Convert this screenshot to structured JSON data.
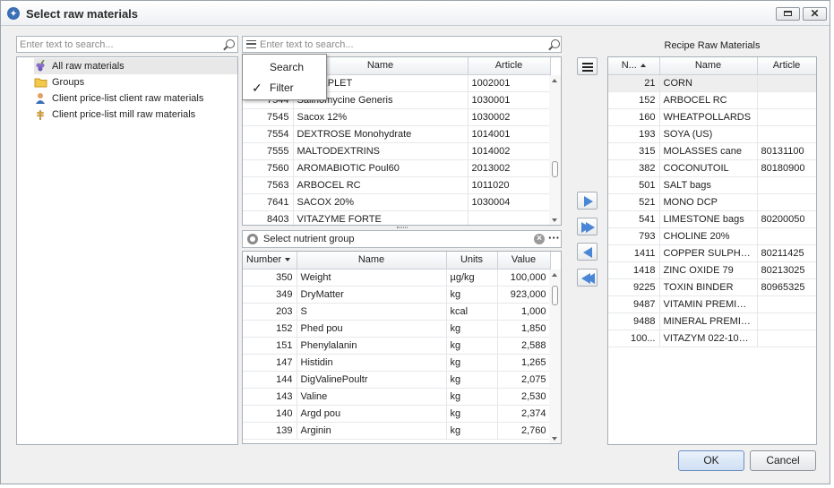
{
  "window": {
    "title": "Select raw materials",
    "app_icon_glyph": "✦"
  },
  "left": {
    "search_placeholder": "Enter text to search...",
    "tree": [
      {
        "label": "All raw materials",
        "icon": "grapes-icon",
        "color": "#8a6fc9",
        "selected": true
      },
      {
        "label": "Groups",
        "icon": "folder-icon",
        "color": "#e8b923",
        "selected": false
      },
      {
        "label": "Client price-list client raw materials",
        "icon": "client-icon",
        "color": "#d98b2b",
        "selected": false
      },
      {
        "label": "Client price-list mill raw materials",
        "icon": "wheat-icon",
        "color": "#c89b3c",
        "selected": false
      }
    ]
  },
  "center": {
    "search_placeholder": "Enter text to search...",
    "menu": {
      "items": [
        {
          "label": "Search",
          "checked": false
        },
        {
          "label": "Filter",
          "checked": true
        }
      ],
      "check_glyph": "✓"
    },
    "columns": [
      "",
      "Name",
      "Article"
    ],
    "rows": [
      {
        "number": "",
        "name": "AD GEPLET",
        "article": "1002001"
      },
      {
        "number": "7544",
        "name": "Salinomycine Generis",
        "article": "1030001"
      },
      {
        "number": "7545",
        "name": "Sacox 12%",
        "article": "1030002"
      },
      {
        "number": "7554",
        "name": "DEXTROSE Monohydrate",
        "article": "1014001"
      },
      {
        "number": "7555",
        "name": "MALTODEXTRINS",
        "article": "1014002"
      },
      {
        "number": "7560",
        "name": "AROMABIOTIC Poul60",
        "article": "2013002"
      },
      {
        "number": "7563",
        "name": "ARBOCEL RC",
        "article": "1011020"
      },
      {
        "number": "7641",
        "name": "SACOX 20%",
        "article": "1030004"
      },
      {
        "number": "8403",
        "name": "VITAZYME FORTE",
        "article": ""
      }
    ]
  },
  "nutrients": {
    "group_label": "Select nutrient group",
    "clear_glyph": "×",
    "more_glyph": "···",
    "columns": [
      "Number",
      "Name",
      "Units",
      "Value"
    ],
    "rows": [
      {
        "number": "350",
        "name": "Weight",
        "units": "µg/kg",
        "value": "100,000"
      },
      {
        "number": "349",
        "name": "DryMatter",
        "units": "kg",
        "value": "923,000"
      },
      {
        "number": "203",
        "name": "S",
        "units": "kcal",
        "value": "1,000"
      },
      {
        "number": "152",
        "name": "Phed pou",
        "units": "kg",
        "value": "1,850"
      },
      {
        "number": "151",
        "name": "Phenylalanin",
        "units": "kg",
        "value": "2,588"
      },
      {
        "number": "147",
        "name": "Histidin",
        "units": "kg",
        "value": "1,265"
      },
      {
        "number": "144",
        "name": "DigValinePoultr",
        "units": "kg",
        "value": "2,075"
      },
      {
        "number": "143",
        "name": "Valine",
        "units": "kg",
        "value": "2,530"
      },
      {
        "number": "140",
        "name": "Argd pou",
        "units": "kg",
        "value": "2,374"
      },
      {
        "number": "139",
        "name": "Arginin",
        "units": "kg",
        "value": "2,760"
      }
    ]
  },
  "recipe": {
    "title": "Recipe Raw Materials",
    "columns": [
      "N...",
      "Name",
      "Article"
    ],
    "rows": [
      {
        "number": "21",
        "name": "CORN",
        "article": ""
      },
      {
        "number": "152",
        "name": "ARBOCEL RC",
        "article": ""
      },
      {
        "number": "160",
        "name": "WHEATPOLLARDS",
        "article": ""
      },
      {
        "number": "193",
        "name": "SOYA (US)",
        "article": ""
      },
      {
        "number": "315",
        "name": "MOLASSES cane",
        "article": "80131100"
      },
      {
        "number": "382",
        "name": "COCONUTOIL",
        "article": "80180900"
      },
      {
        "number": "501",
        "name": "SALT bags",
        "article": ""
      },
      {
        "number": "521",
        "name": "MONO DCP",
        "article": ""
      },
      {
        "number": "541",
        "name": "LIMESTONE bags",
        "article": "80200050"
      },
      {
        "number": "793",
        "name": "CHOLINE 20%",
        "article": ""
      },
      {
        "number": "1411",
        "name": "COPPER SULPH. 25",
        "article": "80211425"
      },
      {
        "number": "1418",
        "name": "ZINC OXIDE 79",
        "article": "80213025"
      },
      {
        "number": "9225",
        "name": "TOXIN BINDER",
        "article": "80965325"
      },
      {
        "number": "9487",
        "name": "VITAMIN PREMIX (...",
        "article": ""
      },
      {
        "number": "9488",
        "name": "MINERAL PREMIX (...",
        "article": ""
      },
      {
        "number": "100...",
        "name": "VITAZYM 022-1000...",
        "article": ""
      }
    ]
  },
  "buttons": {
    "ok": "OK",
    "cancel": "Cancel"
  },
  "colors": {
    "accent_arrow": "#4a86d6",
    "selected_row": "#eeeeee"
  }
}
